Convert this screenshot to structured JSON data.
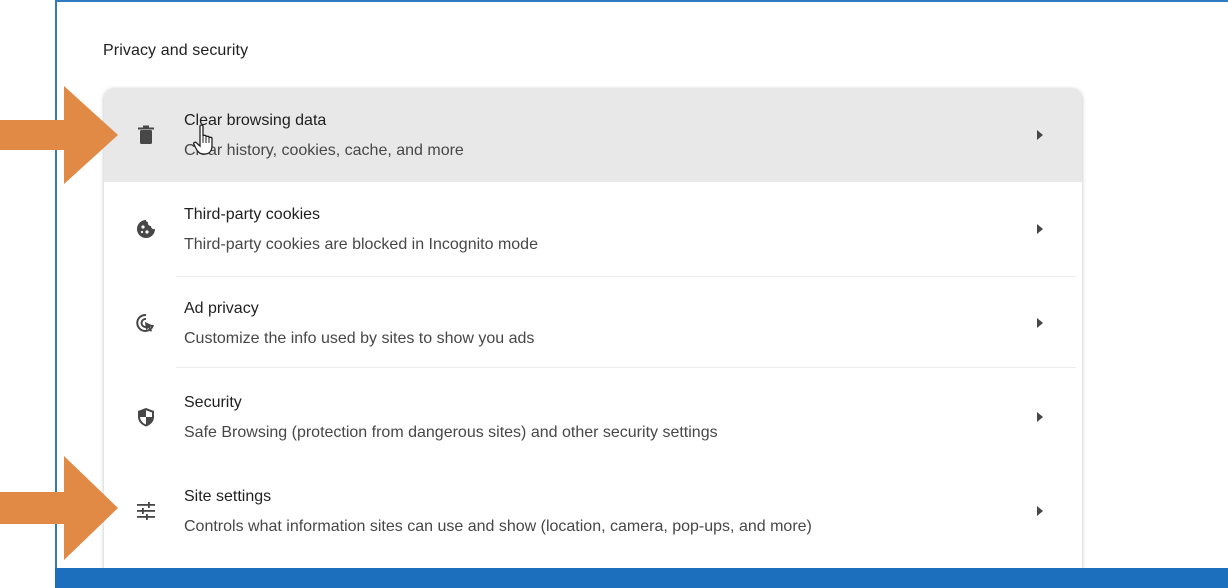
{
  "section": {
    "title": "Privacy and security"
  },
  "rows": [
    {
      "label": "Clear browsing data",
      "sub": "Clear history, cookies, cache, and more",
      "icon": "trash-icon"
    },
    {
      "label": "Third-party cookies",
      "sub": "Third-party cookies are blocked in Incognito mode",
      "icon": "cookie-icon"
    },
    {
      "label": "Ad privacy",
      "sub": "Customize the info used by sites to show you ads",
      "icon": "ad-privacy-icon"
    },
    {
      "label": "Security",
      "sub": "Safe Browsing (protection from dangerous sites) and other security settings",
      "icon": "shield-icon"
    },
    {
      "label": "Site settings",
      "sub": "Controls what information sites can use and show (location, camera, pop-ups, and more)",
      "icon": "tune-icon"
    }
  ],
  "colors": {
    "accent_bar": "#1b6fbd",
    "annotation_arrow": "#e08a45",
    "hover_row": "#e8e8e8"
  }
}
